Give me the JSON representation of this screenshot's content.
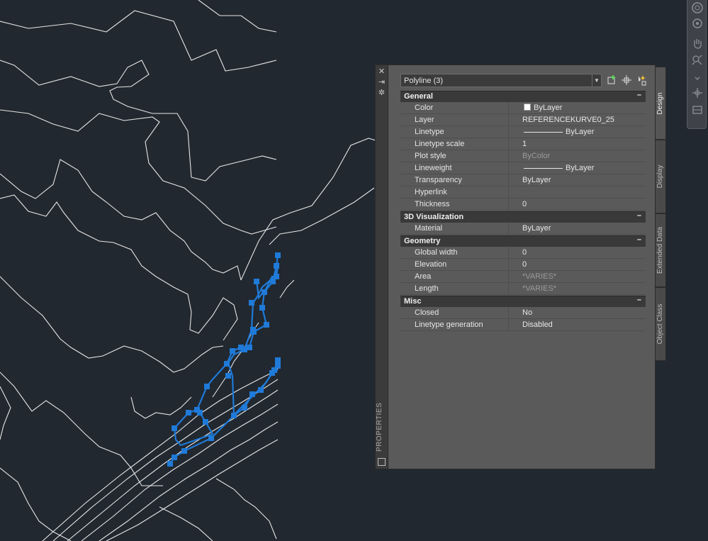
{
  "properties_palette": {
    "title": "PROPERTIES",
    "selector_value": "Polyline (3)",
    "tabs": [
      "Design",
      "Display",
      "Extended Data",
      "Object Class"
    ],
    "categories": [
      {
        "label": "General",
        "collapse": "–",
        "rows": [
          {
            "name": "Color",
            "value": "ByLayer",
            "swatch": true
          },
          {
            "name": "Layer",
            "value": "REFERENCEKURVE0_25"
          },
          {
            "name": "Linetype",
            "value": "ByLayer",
            "line": true
          },
          {
            "name": "Linetype scale",
            "value": "1"
          },
          {
            "name": "Plot style",
            "value": "ByColor",
            "dim": true
          },
          {
            "name": "Lineweight",
            "value": "ByLayer",
            "line": true
          },
          {
            "name": "Transparency",
            "value": "ByLayer"
          },
          {
            "name": "Hyperlink",
            "value": ""
          },
          {
            "name": "Thickness",
            "value": "0"
          }
        ]
      },
      {
        "label": "3D Visualization",
        "collapse": "–",
        "rows": [
          {
            "name": "Material",
            "value": "ByLayer"
          }
        ]
      },
      {
        "label": "Geometry",
        "collapse": "–",
        "rows": [
          {
            "name": "Global width",
            "value": "0"
          },
          {
            "name": "Elevation",
            "value": "0"
          },
          {
            "name": "Area",
            "value": "*VARIES*",
            "dim": true
          },
          {
            "name": "Length",
            "value": "*VARIES*",
            "dim": true
          }
        ]
      },
      {
        "label": "Misc",
        "collapse": "–",
        "rows": [
          {
            "name": "Closed",
            "value": "No"
          },
          {
            "name": "Linetype generation",
            "value": "Disabled"
          }
        ]
      }
    ]
  },
  "colors": {
    "background": "#212830",
    "contour": "#e6e6e6",
    "selection": "#1f7ad8",
    "palette": "#5a5a5a"
  }
}
